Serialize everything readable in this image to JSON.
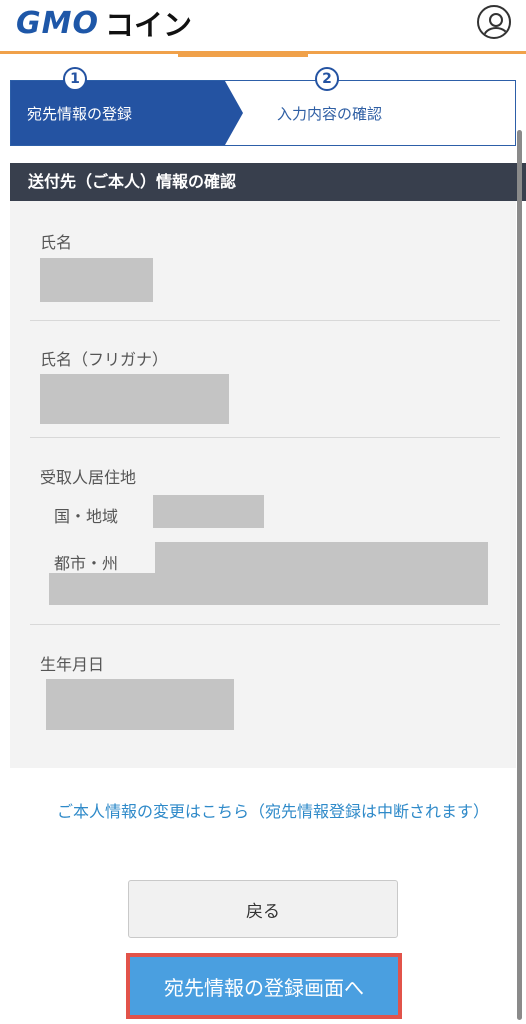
{
  "header": {
    "logo_primary": "GMO",
    "logo_secondary": "コイン",
    "avatar_icon": "user-circle-icon",
    "accent_color": "#f0a14a"
  },
  "steps": [
    {
      "number": "1",
      "label": "宛先情報の登録",
      "active": true
    },
    {
      "number": "2",
      "label": "入力内容の確認",
      "active": false
    }
  ],
  "section": {
    "title": "送付先（ご本人）情報の確認"
  },
  "fields": {
    "name_label": "氏名",
    "kana_label": "氏名（フリガナ）",
    "residence_label": "受取人居住地",
    "country_label": "国・地域",
    "city_label": "都市・州",
    "birth_label": "生年月日"
  },
  "links": {
    "change_info": "ご本人情報の変更はこちら（宛先情報登録は中断されます）"
  },
  "buttons": {
    "back": "戻る",
    "to_register": "宛先情報の登録画面へ"
  },
  "colors": {
    "brand_blue": "#2453a2",
    "section_dark": "#383f4d",
    "link_blue": "#2f8ac9",
    "primary_button": "#4a9fe0",
    "highlight_red": "#e2534a"
  }
}
